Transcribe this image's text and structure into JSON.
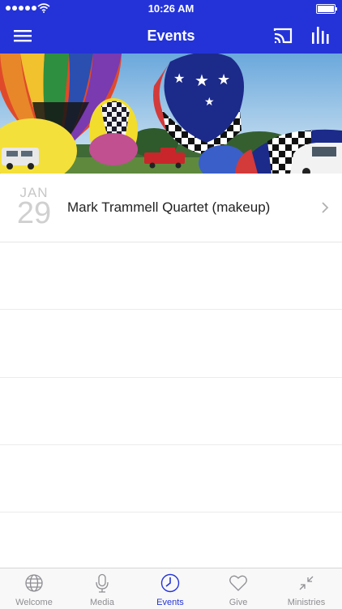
{
  "status_bar": {
    "time": "10:26 AM"
  },
  "nav": {
    "title": "Events"
  },
  "events": [
    {
      "month": "JAN",
      "day": "29",
      "name": "Mark Trammell Quartet  (makeup)"
    }
  ],
  "tabs": [
    {
      "label": "Welcome",
      "icon": "globe-icon",
      "active": false
    },
    {
      "label": "Media",
      "icon": "microphone-icon",
      "active": false
    },
    {
      "label": "Events",
      "icon": "clock-icon",
      "active": true
    },
    {
      "label": "Give",
      "icon": "heart-icon",
      "active": false
    },
    {
      "label": "Ministries",
      "icon": "arrows-inward-icon",
      "active": false
    }
  ],
  "colors": {
    "accent": "#2433d8",
    "inactive": "#8e8e93"
  }
}
